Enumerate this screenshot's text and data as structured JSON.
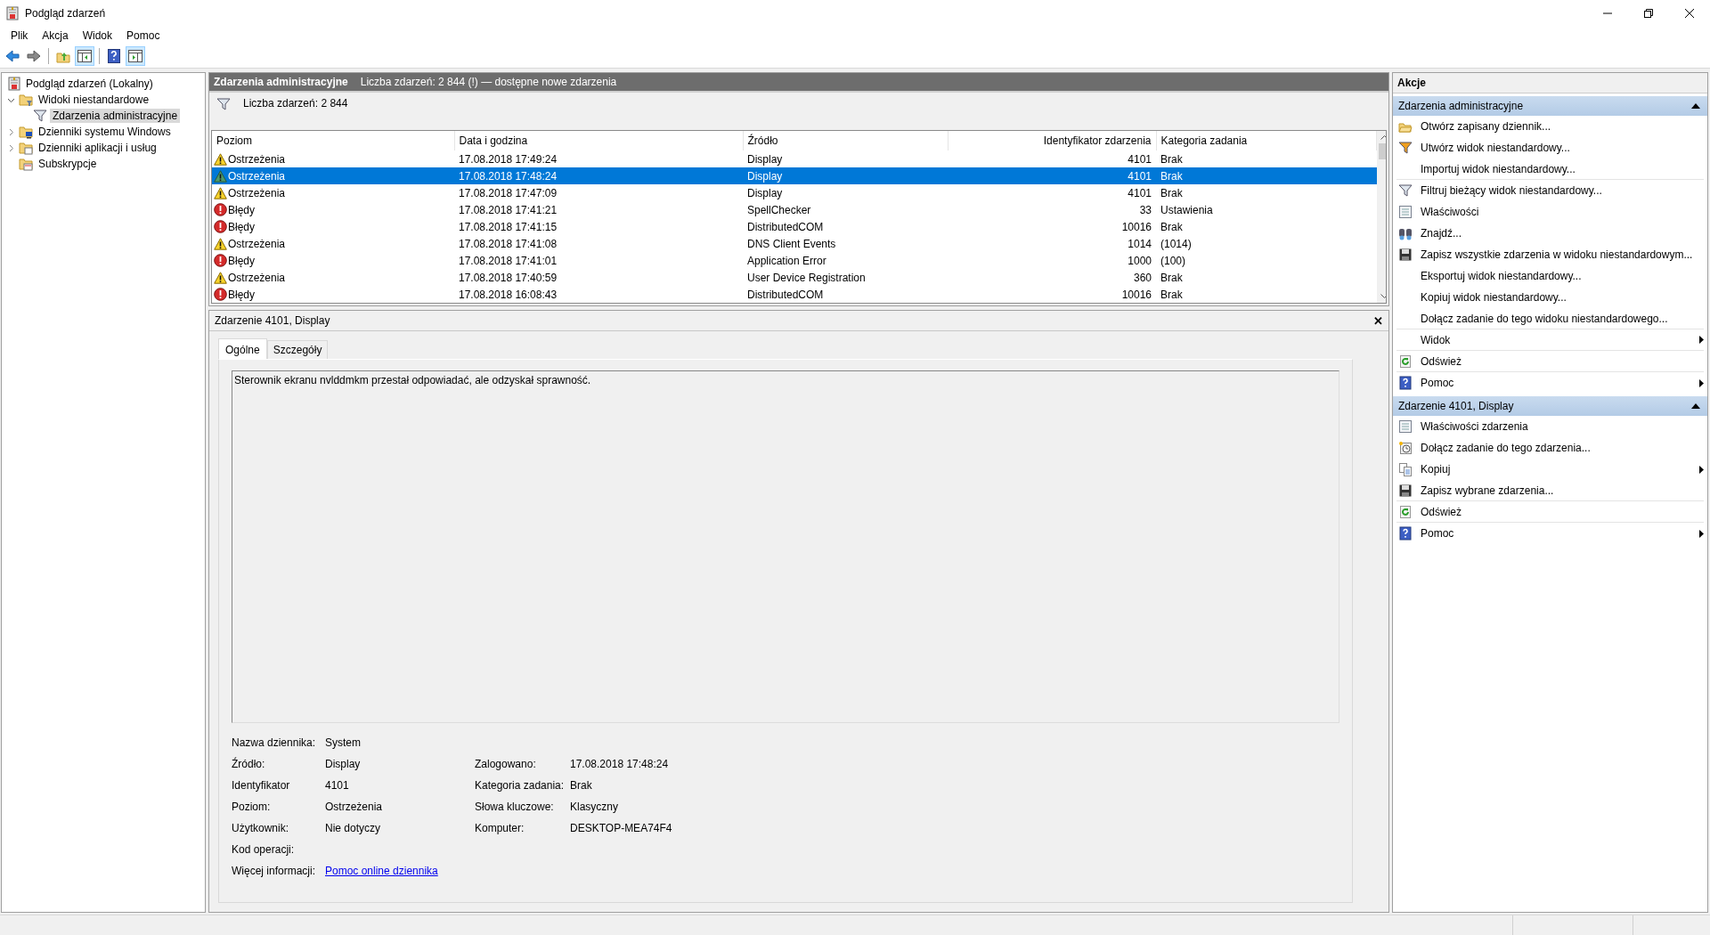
{
  "window": {
    "title": "Podgląd zdarzeń"
  },
  "menu": [
    "Plik",
    "Akcja",
    "Widok",
    "Pomoc"
  ],
  "toolbar": [
    {
      "pressed": false
    },
    {
      "pressed": false
    },
    {
      "pressed": false
    },
    {
      "pressed": true
    },
    {
      "pressed": false
    },
    {
      "pressed": true
    }
  ],
  "tree": {
    "label": "Podgląd zdarzeń (Lokalny)",
    "children": [
      {
        "label": "Widoki niestandardowe",
        "has_children": true,
        "expanded": true,
        "selected": false,
        "children": [
          {
            "label": "Zdarzenia administracyjne",
            "has_children": false,
            "selected": true
          }
        ]
      },
      {
        "label": "Dzienniki systemu Windows",
        "has_children": true,
        "expanded": false,
        "selected": false
      },
      {
        "label": "Dzienniki aplikacji i usług",
        "has_children": true,
        "expanded": false,
        "selected": false
      },
      {
        "label": "Subskrypcje",
        "has_children": false,
        "selected": false
      }
    ]
  },
  "view": {
    "title": "Zdarzenia administracyjne",
    "notice": "Liczba zdarzeń: 2 844 (!) — dostępne nowe zdarzenia",
    "filter": "Liczba zdarzeń: 2 844"
  },
  "table": {
    "columns": [
      "Poziom",
      "Data i godzina",
      "Źródło",
      "Identyfikator zdarzenia",
      "Kategoria zadania"
    ],
    "rows": [
      {
        "kind": "warning",
        "level": "Ostrzeżenia",
        "date": "17.08.2018 17:49:24",
        "source": "Display",
        "id": "4101",
        "category": "Brak",
        "selected": false
      },
      {
        "kind": "warning",
        "level": "Ostrzeżenia",
        "date": "17.08.2018 17:48:24",
        "source": "Display",
        "id": "4101",
        "category": "Brak",
        "selected": true
      },
      {
        "kind": "warning",
        "level": "Ostrzeżenia",
        "date": "17.08.2018 17:47:09",
        "source": "Display",
        "id": "4101",
        "category": "Brak",
        "selected": false
      },
      {
        "kind": "error",
        "level": "Błędy",
        "date": "17.08.2018 17:41:21",
        "source": "SpellChecker",
        "id": "33",
        "category": "Ustawienia",
        "selected": false
      },
      {
        "kind": "error",
        "level": "Błędy",
        "date": "17.08.2018 17:41:15",
        "source": "DistributedCOM",
        "id": "10016",
        "category": "Brak",
        "selected": false
      },
      {
        "kind": "warning",
        "level": "Ostrzeżenia",
        "date": "17.08.2018 17:41:08",
        "source": "DNS Client Events",
        "id": "1014",
        "category": "(1014)",
        "selected": false
      },
      {
        "kind": "error",
        "level": "Błędy",
        "date": "17.08.2018 17:41:01",
        "source": "Application Error",
        "id": "1000",
        "category": "(100)",
        "selected": false
      },
      {
        "kind": "warning",
        "level": "Ostrzeżenia",
        "date": "17.08.2018 17:40:59",
        "source": "User Device Registration",
        "id": "360",
        "category": "Brak",
        "selected": false
      },
      {
        "kind": "error",
        "level": "Błędy",
        "date": "17.08.2018 16:08:43",
        "source": "DistributedCOM",
        "id": "10016",
        "category": "Brak",
        "selected": false
      }
    ]
  },
  "details": {
    "title": "Zdarzenie 4101, Display",
    "close": "✕",
    "tabs": [
      {
        "label": "Ogólne",
        "selected": true
      },
      {
        "label": "Szczegóły",
        "selected": false
      }
    ],
    "message": "Sterownik ekranu nvlddmkm przestał odpowiadać, ale odzyskał sprawność.",
    "rows": [
      [
        {
          "label": "Nazwa dziennika:",
          "value": "System"
        }
      ],
      [
        {
          "label": "Źródło:",
          "value": "Display"
        },
        {
          "label": "Zalogowano:",
          "value": "17.08.2018 17:48:24"
        }
      ],
      [
        {
          "label": "Identyfikator",
          "value": "4101"
        },
        {
          "label": "Kategoria zadania:",
          "value": "Brak"
        }
      ],
      [
        {
          "label": "Poziom:",
          "value": "Ostrzeżenia"
        },
        {
          "label": "Słowa kluczowe:",
          "value": "Klasyczny"
        }
      ],
      [
        {
          "label": "Użytkownik:",
          "value": "Nie dotyczy"
        },
        {
          "label": "Komputer:",
          "value": "DESKTOP-MEA74F4"
        }
      ],
      [
        {
          "label": "Kod operacji:"
        }
      ],
      [
        {
          "label": "Więcej informacji:",
          "link": "Pomoc online dziennika"
        }
      ]
    ]
  },
  "actions": {
    "title": "Akcje",
    "sections": [
      {
        "title": "Zdarzenia administracyjne",
        "expanded": true,
        "items": [
          {
            "label": "Otwórz zapisany dziennik...",
            "submenu": false,
            "divider_after": false
          },
          {
            "label": "Utwórz widok niestandardowy...",
            "submenu": false,
            "divider_after": false
          },
          {
            "label": "Importuj widok niestandardowy...",
            "submenu": false,
            "divider_after": true
          },
          {
            "label": "Filtruj bieżący widok niestandardowy...",
            "submenu": false,
            "divider_after": false
          },
          {
            "label": "Właściwości",
            "submenu": false,
            "divider_after": false
          },
          {
            "label": "Znajdź...",
            "submenu": false,
            "divider_after": false
          },
          {
            "label": "Zapisz wszystkie zdarzenia w widoku niestandardowym...",
            "submenu": false,
            "divider_after": false
          },
          {
            "label": "Eksportuj widok niestandardowy...",
            "submenu": false,
            "divider_after": false
          },
          {
            "label": "Kopiuj widok niestandardowy...",
            "submenu": false,
            "divider_after": false
          },
          {
            "label": "Dołącz zadanie do tego widoku niestandardowego...",
            "submenu": false,
            "divider_after": true
          },
          {
            "label": "Widok",
            "submenu": true,
            "divider_after": true
          },
          {
            "label": "Odśwież",
            "submenu": false,
            "divider_after": true
          },
          {
            "label": "Pomoc",
            "submenu": true,
            "divider_after": false
          }
        ]
      },
      {
        "title": "Zdarzenie 4101, Display",
        "expanded": true,
        "items": [
          {
            "label": "Właściwości zdarzenia",
            "submenu": false,
            "divider_after": false
          },
          {
            "label": "Dołącz zadanie do tego zdarzenia...",
            "submenu": false,
            "divider_after": false
          },
          {
            "label": "Kopiuj",
            "submenu": true,
            "divider_after": false
          },
          {
            "label": "Zapisz wybrane zdarzenia...",
            "submenu": false,
            "divider_after": true
          },
          {
            "label": "Odśwież",
            "submenu": false,
            "divider_after": true
          },
          {
            "label": "Pomoc",
            "submenu": true,
            "divider_after": false
          }
        ]
      }
    ]
  }
}
